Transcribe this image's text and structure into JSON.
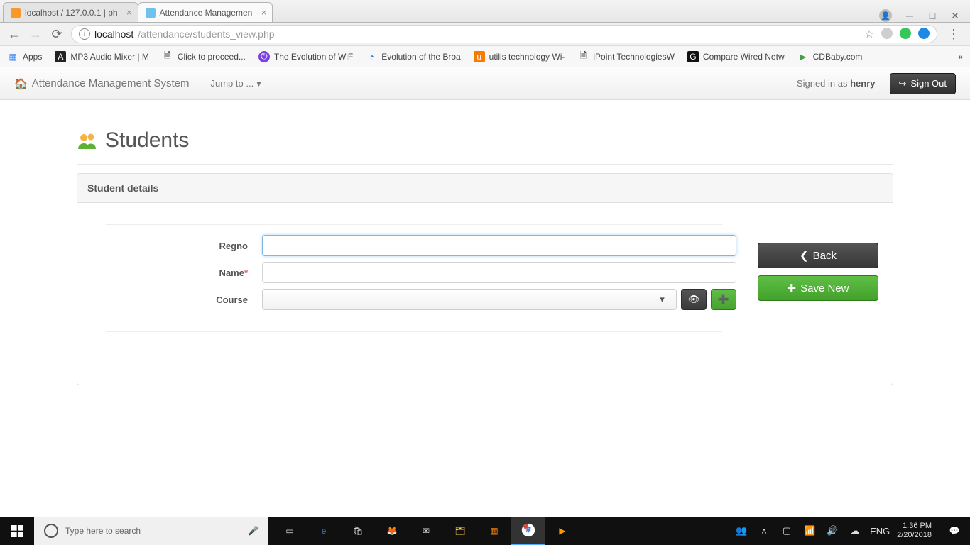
{
  "chrome": {
    "tabs": [
      {
        "title": "localhost / 127.0.0.1 | ph",
        "active": false
      },
      {
        "title": "Attendance Managemen",
        "active": true
      }
    ],
    "url_host": "localhost",
    "url_path": "/attendance/students_view.php",
    "bookmarks": [
      {
        "label": "Apps"
      },
      {
        "label": "MP3 Audio Mixer | M"
      },
      {
        "label": "Click to proceed..."
      },
      {
        "label": "The Evolution of WiF"
      },
      {
        "label": "Evolution of the Broa"
      },
      {
        "label": "utilis technology Wi-"
      },
      {
        "label": "iPoint TechnologiesW"
      },
      {
        "label": "Compare Wired Netw"
      },
      {
        "label": "CDBaby.com"
      }
    ]
  },
  "navbar": {
    "brand": "Attendance Management System",
    "jump": "Jump to ...",
    "signed_in_prefix": "Signed in as ",
    "signed_in_user": "henry",
    "signout": "Sign Out"
  },
  "page": {
    "title": "Students",
    "panel_title": "Student details",
    "labels": {
      "regno": "Regno",
      "name": "Name",
      "course": "Course"
    },
    "required_mark": "*",
    "values": {
      "regno": "",
      "name": "",
      "course": ""
    },
    "course_placeholder": "",
    "back": "Back",
    "save_new": "Save New"
  },
  "taskbar": {
    "search_placeholder": "Type here to search",
    "lang": "ENG",
    "time": "1:36 PM",
    "date": "2/20/2018"
  }
}
